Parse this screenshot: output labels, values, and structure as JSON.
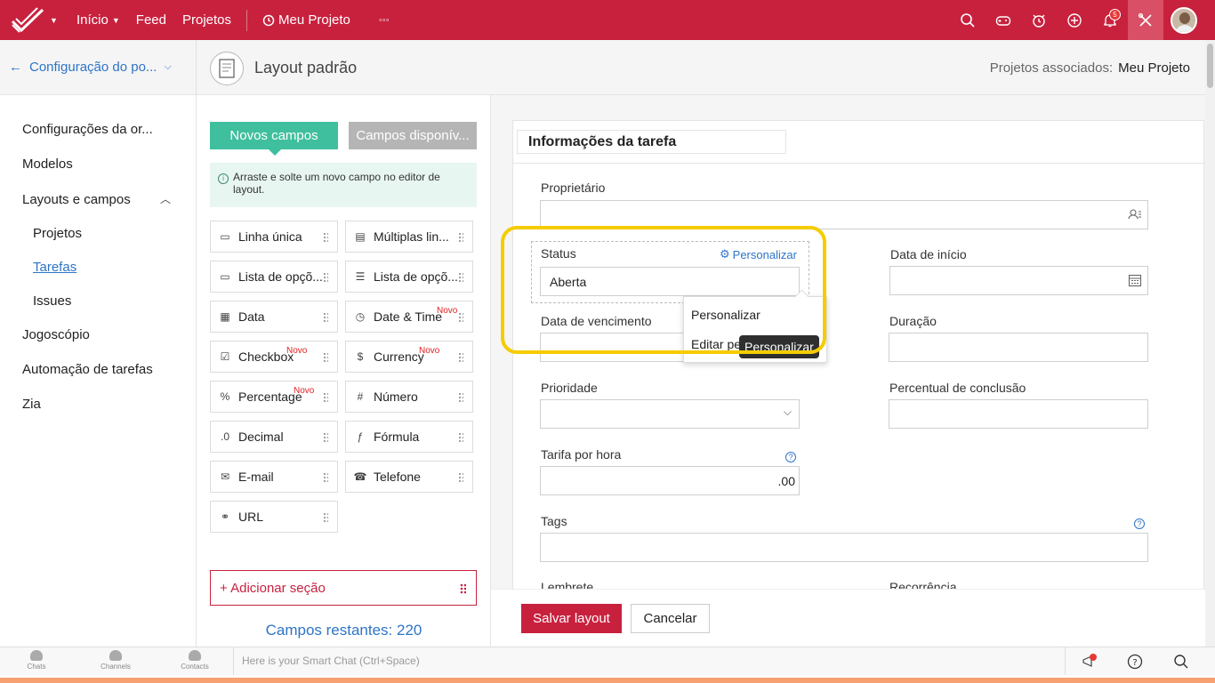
{
  "topbar": {
    "nav": [
      {
        "label": "Início",
        "caret": true
      },
      {
        "label": "Feed",
        "caret": false
      },
      {
        "label": "Projetos",
        "caret": false
      }
    ],
    "project": "Meu Projeto",
    "more": "◦◦◦",
    "notification_count": "5",
    "accent": "#c8213e"
  },
  "header": {
    "back_label": "Configuração do po...",
    "layout_title": "Layout padrão",
    "assoc_label": "Projetos associados:",
    "assoc_value": "Meu Projeto"
  },
  "sidebar": {
    "items": [
      "Configurações da or...",
      "Modelos",
      "Layouts e campos",
      "Jogoscópio",
      "Automação de tarefas",
      "Zia"
    ],
    "sub_items": [
      "Projetos",
      "Tarefas",
      "Issues"
    ],
    "active_sub": "Tarefas"
  },
  "fields_panel": {
    "tab_new": "Novos campos",
    "tab_available": "Campos disponív...",
    "info": "Arraste e solte um novo campo no editor de layout.",
    "fields": [
      {
        "label": "Linha única",
        "icon": "single-line-icon",
        "novo": ""
      },
      {
        "label": "Múltiplas lin...",
        "icon": "multi-line-icon",
        "novo": ""
      },
      {
        "label": "Lista de opçõ...",
        "icon": "picklist-icon",
        "novo": ""
      },
      {
        "label": "Lista de opçõ...",
        "icon": "multiselect-icon",
        "novo": ""
      },
      {
        "label": "Data",
        "icon": "date-icon",
        "novo": ""
      },
      {
        "label": "Date & Time",
        "icon": "datetime-icon",
        "novo": "Novo"
      },
      {
        "label": "Checkbox",
        "icon": "checkbox-icon",
        "novo": "Novo"
      },
      {
        "label": "Currency",
        "icon": "currency-icon",
        "novo": "Novo"
      },
      {
        "label": "Percentage",
        "icon": "percent-icon",
        "novo": "Novo"
      },
      {
        "label": "Número",
        "icon": "number-icon",
        "novo": ""
      },
      {
        "label": "Decimal",
        "icon": "decimal-icon",
        "novo": ""
      },
      {
        "label": "Fórmula",
        "icon": "formula-icon",
        "novo": ""
      },
      {
        "label": "E-mail",
        "icon": "email-icon",
        "novo": ""
      },
      {
        "label": "Telefone",
        "icon": "phone-icon",
        "novo": ""
      },
      {
        "label": "URL",
        "icon": "link-icon",
        "novo": ""
      }
    ],
    "add_section": "+ Adicionar seção",
    "remaining": "Campos restantes: 220"
  },
  "editor": {
    "section_title": "Informações da tarefa",
    "owner_label": "Proprietário",
    "status_label": "Status",
    "status_value": "Aberta",
    "personalize_link": "Personalizar",
    "start_label": "Data de início",
    "due_label": "Data de vencimento",
    "duration_label": "Duração",
    "priority_label": "Prioridade",
    "completion_label": "Percentual de conclusão",
    "rate_label": "Tarifa por hora",
    "rate_value": ".00",
    "tags_label": "Tags",
    "reminder_label": "Lembrete",
    "recurrence_label": "Recorrência",
    "menu_items": [
      "Personalizar",
      "Editar pe"
    ],
    "tooltip": "Personalizar"
  },
  "actions": {
    "save": "Salvar layout",
    "cancel": "Cancelar"
  },
  "bottombar": {
    "chats": "Chats",
    "channels": "Channels",
    "contacts": "Contacts",
    "chat_placeholder": "Here is your Smart Chat (Ctrl+Space)"
  }
}
